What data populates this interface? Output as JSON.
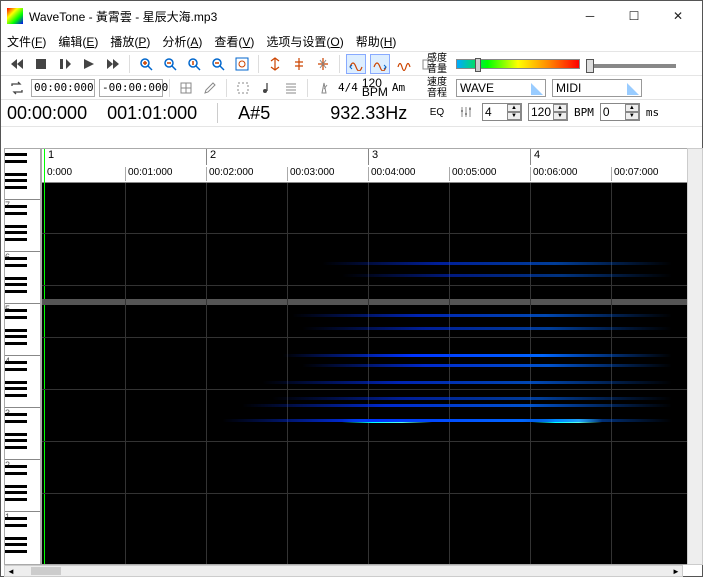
{
  "title": "WaveTone - 黃霄雲 - 星辰大海.mp3",
  "menu": {
    "file": "文件(",
    "file_k": "F",
    "edit": "编辑(",
    "edit_k": "E",
    "play": "播放(",
    "play_k": "P",
    "analyze": "分析(",
    "analyze_k": "A",
    "view": "查看(",
    "view_k": "V",
    "options": "选项与设置(",
    "options_k": "O",
    "help": "帮助(",
    "help_k": "H"
  },
  "toolbar2": {
    "time1": "00:00:000",
    "time2": "-00:00:000",
    "timesig": "4/4",
    "bpm_lbl": "120",
    "bpm_sub": "BPM",
    "key": "Am"
  },
  "status": {
    "t1": "00:00:000",
    "t2": "001:01:000",
    "note": "A#5",
    "freq": "932.33Hz"
  },
  "labels": {
    "sens": "感度",
    "vol": "音量",
    "speed": "速度",
    "pitch": "音程",
    "eq": "EQ",
    "bpm": "BPM",
    "ms": "ms",
    "wave": "WAVE",
    "midi": "MIDI"
  },
  "fields": {
    "num1": "4",
    "num2": "120",
    "num3": "0"
  },
  "ruler": {
    "bars": [
      "1",
      "2",
      "3",
      "4"
    ],
    "times": [
      "0:000",
      "00:01:000",
      "00:02:000",
      "00:03:000",
      "00:04:000",
      "00:05:000",
      "00:06:000",
      "00:07:000"
    ]
  },
  "octaves": [
    "7",
    "6",
    "5",
    "4",
    "3",
    "2",
    "1"
  ]
}
